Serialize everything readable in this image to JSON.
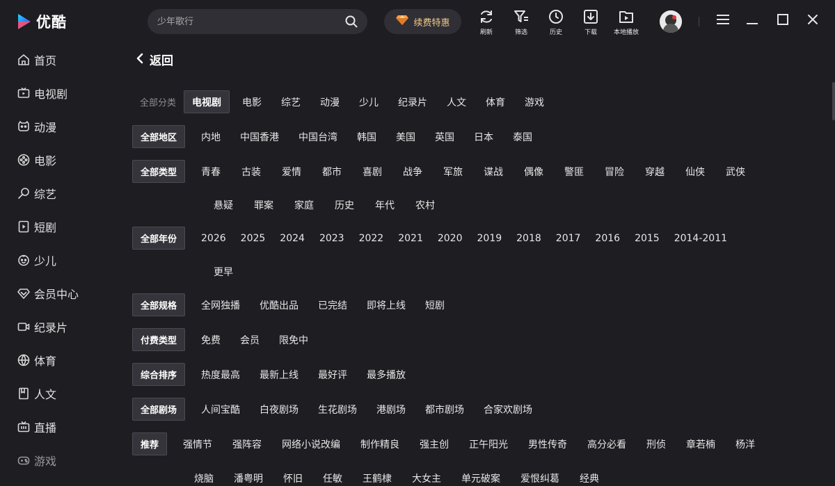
{
  "app": {
    "name": "优酷"
  },
  "search": {
    "placeholder": "少年歌行"
  },
  "vip": {
    "label": "续费特惠"
  },
  "toolbar": {
    "refresh": "刷新",
    "filter": "筛选",
    "history": "历史",
    "download": "下载",
    "local_play": "本地播放"
  },
  "sidebar": {
    "items": [
      {
        "label": "首页",
        "icon": "home-icon"
      },
      {
        "label": "电视剧",
        "icon": "tv-icon"
      },
      {
        "label": "动漫",
        "icon": "anime-icon"
      },
      {
        "label": "电影",
        "icon": "film-reel-icon"
      },
      {
        "label": "综艺",
        "icon": "microphone-icon"
      },
      {
        "label": "短剧",
        "icon": "play-square-icon"
      },
      {
        "label": "少儿",
        "icon": "child-face-icon"
      },
      {
        "label": "会员中心",
        "icon": "diamond-icon"
      },
      {
        "label": "纪录片",
        "icon": "camera-icon"
      },
      {
        "label": "体育",
        "icon": "ball-icon"
      },
      {
        "label": "人文",
        "icon": "book-icon"
      },
      {
        "label": "直播",
        "icon": "live-tv-icon"
      },
      {
        "label": "游戏",
        "icon": "gamepad-icon"
      }
    ]
  },
  "back": {
    "label": "返回"
  },
  "filters": {
    "category": {
      "head": "全部分类",
      "items": [
        "电视剧",
        "电影",
        "综艺",
        "动漫",
        "少儿",
        "纪录片",
        "人文",
        "体育",
        "游戏"
      ],
      "active": "电视剧"
    },
    "region": {
      "head": "全部地区",
      "items": [
        "内地",
        "中国香港",
        "中国台湾",
        "韩国",
        "美国",
        "英国",
        "日本",
        "泰国"
      ]
    },
    "genre": {
      "head": "全部类型",
      "items": [
        "青春",
        "古装",
        "爱情",
        "都市",
        "喜剧",
        "战争",
        "军旅",
        "谍战",
        "偶像",
        "警匪",
        "冒险",
        "穿越",
        "仙侠",
        "武侠"
      ],
      "items2": [
        "悬疑",
        "罪案",
        "家庭",
        "历史",
        "年代",
        "农村"
      ]
    },
    "year": {
      "head": "全部年份",
      "items": [
        "2026",
        "2025",
        "2024",
        "2023",
        "2022",
        "2021",
        "2020",
        "2019",
        "2018",
        "2017",
        "2016",
        "2015",
        "2014-2011"
      ],
      "items2": [
        "更早"
      ]
    },
    "spec": {
      "head": "全部规格",
      "items": [
        "全网独播",
        "优酷出品",
        "已完结",
        "即将上线",
        "短剧"
      ]
    },
    "pay": {
      "head": "付费类型",
      "items": [
        "免费",
        "会员",
        "限免中"
      ]
    },
    "sort": {
      "head": "综合排序",
      "items": [
        "热度最高",
        "最新上线",
        "最好评",
        "最多播放"
      ]
    },
    "theater": {
      "head": "全部剧场",
      "items": [
        "人间宝酷",
        "白夜剧场",
        "生花剧场",
        "港剧场",
        "都市剧场",
        "合家欢剧场"
      ]
    },
    "recommend": {
      "head": "推荐",
      "items": [
        "强情节",
        "强阵容",
        "网络小说改编",
        "制作精良",
        "强主创",
        "正午阳光",
        "男性传奇",
        "高分必看",
        "刑侦",
        "章若楠",
        "杨洋"
      ],
      "items2": [
        "烧脑",
        "潘粤明",
        "怀旧",
        "任敏",
        "王鹤棣",
        "大女主",
        "单元破案",
        "爱恨纠葛",
        "经典"
      ]
    }
  },
  "colors": {
    "background": "#1d1d22",
    "chip_bg": "#34343a",
    "vip_gold": "#f3c98a",
    "logo_blue": "#1da1f2"
  }
}
